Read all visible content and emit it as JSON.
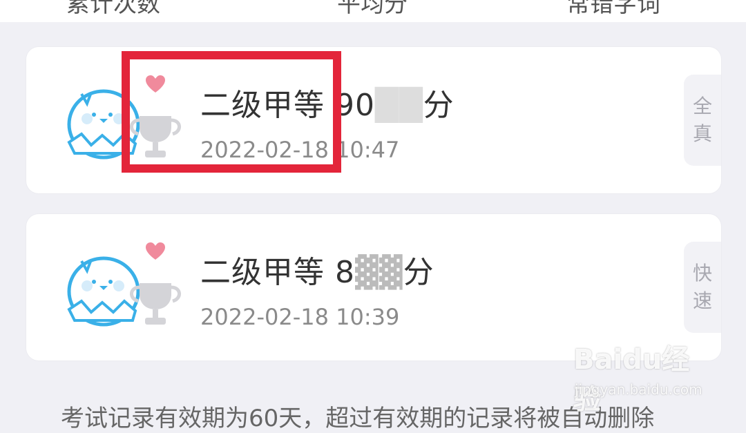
{
  "top_tabs": [
    "累计次数",
    "平均分",
    "常错字词"
  ],
  "records": [
    {
      "title": "二级甲等 90",
      "title_suffix": "分",
      "date": "2022-02-18 10:47",
      "mode": [
        "全",
        "真"
      ]
    },
    {
      "title": "二级甲等 8",
      "title_suffix": "分",
      "date": "2022-02-18 10:39",
      "mode": [
        "快",
        "速"
      ]
    }
  ],
  "footer_note": "考试记录有效期为60天，超过有效期的记录将被自动删除",
  "watermark": {
    "brand": "Baidu经验",
    "url": "jingyan.baidu.com"
  },
  "colors": {
    "highlight": "#e3253a",
    "mascot": "#3ab0e8",
    "heart": "#f08a9c"
  }
}
